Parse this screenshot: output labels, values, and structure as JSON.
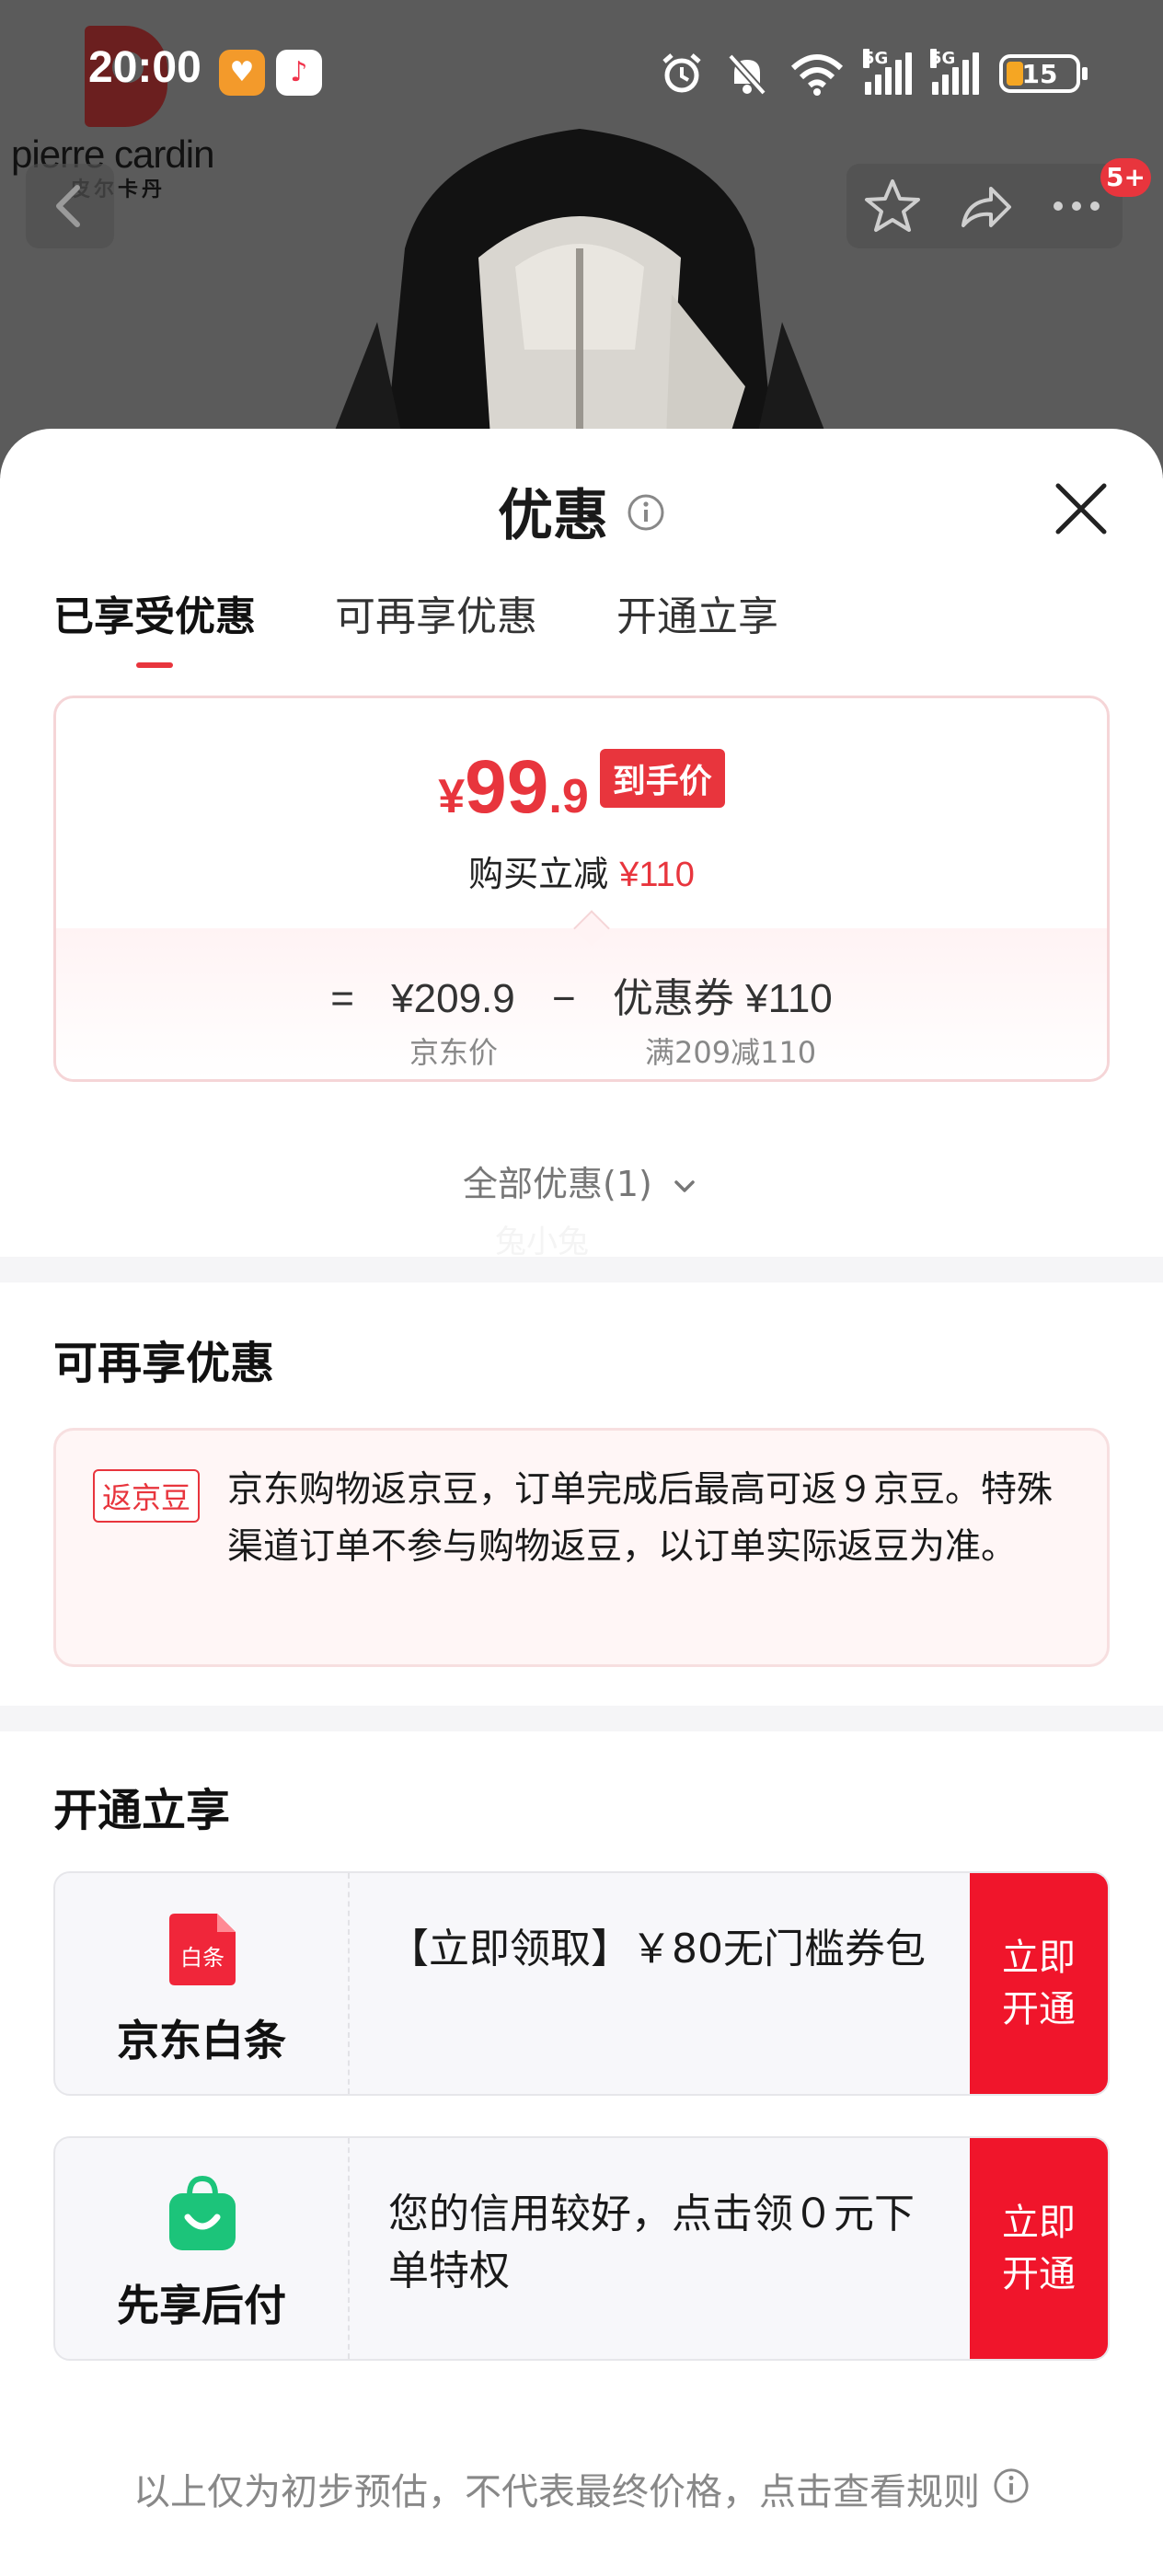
{
  "status_bar": {
    "time": "20:00",
    "network_1": "5G",
    "network_2": "5G",
    "battery": "15"
  },
  "brand": {
    "name": "pierre cardin",
    "sub": "皮尔卡丹"
  },
  "nav": {
    "badge": "5+"
  },
  "sheet": {
    "title": "优惠",
    "tabs": [
      "已享受优惠",
      "可再享优惠",
      "开通立享"
    ]
  },
  "price_card": {
    "currency": "¥",
    "price_int": "99",
    "price_dec": ".9",
    "price_tag": "到手价",
    "discount_label": "购买立减",
    "discount_value": "¥110",
    "formula_eq": "=",
    "jd_price": "¥209.9",
    "formula_minus": "−",
    "coupon_label": "优惠券",
    "coupon_value": "¥110",
    "jd_price_caption": "京东价",
    "coupon_caption": "满209减110"
  },
  "all_offers": "全部优惠(1)",
  "watermark": "兔小兔",
  "more_offers": {
    "heading": "可再享优惠",
    "tag": "返京豆",
    "text": "京东购物返京豆，订单完成后最高可返９京豆。特殊渠道订单不参与购物返豆，以订单实际返豆为准。"
  },
  "open_enjoy": {
    "heading": "开通立享",
    "items": [
      {
        "icon_text": "白条",
        "name": "京东白条",
        "text": "【立即领取】￥80无门槛券包",
        "button": "立即开通"
      },
      {
        "icon_text": "",
        "name": "先享后付",
        "text": "您的信用较好，点击领０元下单特权",
        "button": "立即开通"
      }
    ]
  },
  "footer_note": "以上仅为初步预估，不代表最终价格，点击查看规则",
  "colors": {
    "accent": "#e8353d",
    "button_red": "#f0152b",
    "baitiao_red": "#f0263a",
    "xianxiang_green": "#1cc47a"
  }
}
